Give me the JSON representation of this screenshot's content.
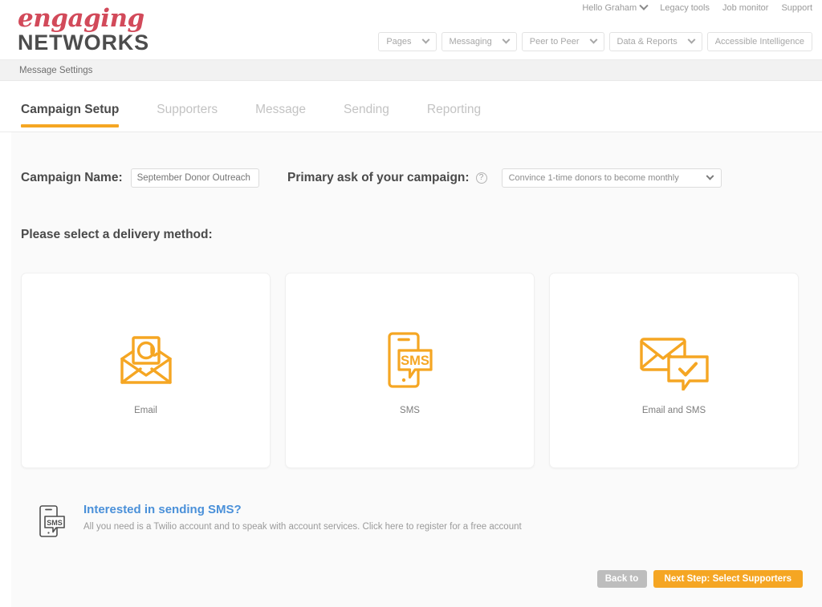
{
  "brand": {
    "logo_line1": "engaging",
    "logo_line2": "NETWORKS",
    "accent_orange": "#f5a623",
    "logo_red": "#d24a5a",
    "link_blue": "#4a90d9"
  },
  "utility_nav": {
    "greeting": "Hello Graham",
    "items": [
      {
        "label": "Legacy tools"
      },
      {
        "label": "Job monitor"
      },
      {
        "label": "Support"
      }
    ]
  },
  "main_nav": {
    "buttons": [
      {
        "label": "Pages",
        "has_chevron": true
      },
      {
        "label": "Messaging",
        "has_chevron": true
      },
      {
        "label": "Peer to Peer",
        "has_chevron": true
      },
      {
        "label": "Data & Reports",
        "has_chevron": true
      },
      {
        "label": "Accessible Intelligence",
        "has_chevron": false
      }
    ]
  },
  "breadcrumb": {
    "label": "Message Settings"
  },
  "tabs": [
    {
      "label": "Campaign Setup",
      "active": true
    },
    {
      "label": "Supporters",
      "active": false
    },
    {
      "label": "Message",
      "active": false
    },
    {
      "label": "Sending",
      "active": false
    },
    {
      "label": "Reporting",
      "active": false
    }
  ],
  "form": {
    "campaign_name_label": "Campaign Name:",
    "campaign_name_placeholder": "September Donor Outreach",
    "campaign_name_value": "",
    "primary_ask_label": "Primary ask of your campaign:",
    "help_icon_glyph": "?",
    "primary_ask_selected": "Convince 1-time donors to become monthly"
  },
  "delivery": {
    "heading": "Please select a delivery method:",
    "methods": [
      {
        "label": "Email",
        "icon": "email-envelope-at-icon"
      },
      {
        "label": "SMS",
        "icon": "sms-phone-bubble-icon"
      },
      {
        "label": "Email and SMS",
        "icon": "email-sms-check-icon"
      }
    ]
  },
  "promo": {
    "icon": "sms-phone-small-icon",
    "title": "Interested in sending SMS?",
    "subtitle": "All you need is a Twilio account and to speak with account services.  Click here to register for a free account"
  },
  "footer": {
    "back_label": "Back to",
    "next_label": "Next Step: Select Supporters"
  }
}
